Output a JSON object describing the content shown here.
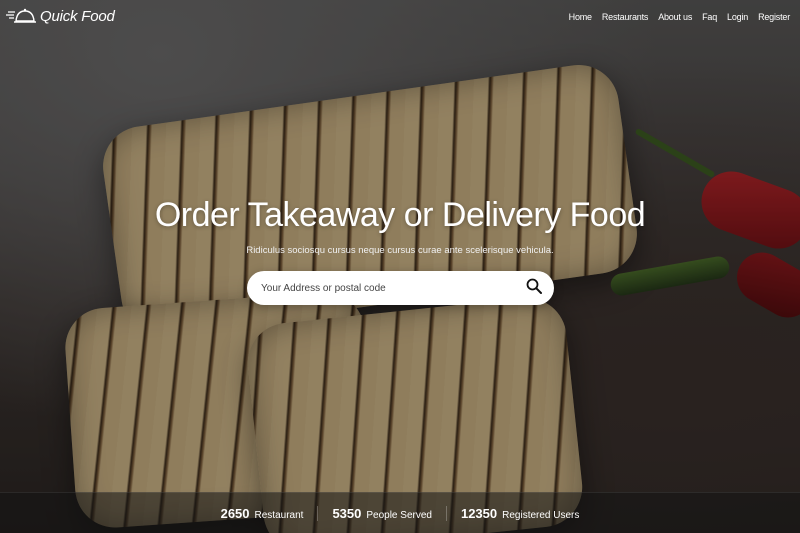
{
  "brand": {
    "name": "Quick Food",
    "icon": "cloche-icon"
  },
  "nav": {
    "items": [
      {
        "label": "Home"
      },
      {
        "label": "Restaurants"
      },
      {
        "label": "About us"
      },
      {
        "label": "Faq"
      },
      {
        "label": "Login"
      },
      {
        "label": "Register"
      }
    ]
  },
  "hero": {
    "title": "Order Takeaway or Delivery Food",
    "subtitle": "Ridiculus sociosqu cursus neque cursus curae ante scelerisque vehicula.",
    "search": {
      "placeholder": "Your Address or postal code",
      "value": "",
      "button_icon": "search-icon"
    }
  },
  "stats": [
    {
      "number": "2650",
      "label": "Restaurant"
    },
    {
      "number": "5350",
      "label": "People Served"
    },
    {
      "number": "12350",
      "label": "Registered Users"
    }
  ],
  "colors": {
    "text": "#ffffff",
    "search_bg": "#ffffff",
    "stats_bar": "#141414"
  }
}
